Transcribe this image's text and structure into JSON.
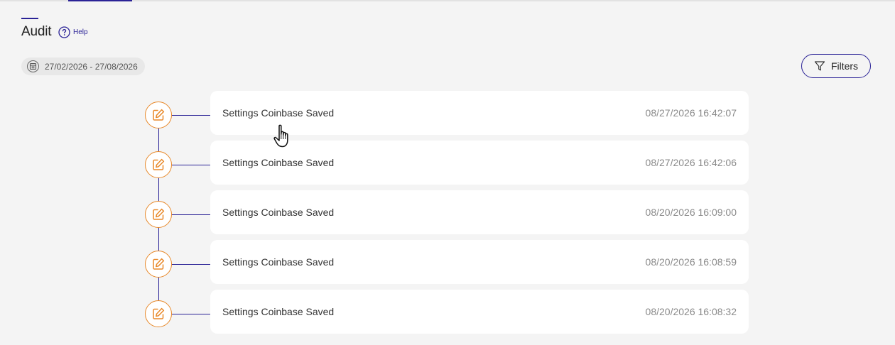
{
  "page": {
    "title": "Audit",
    "help_label": "Help"
  },
  "date_range": {
    "label": "27/02/2026 - 27/08/2026",
    "icon": "calendar-icon"
  },
  "filters": {
    "label": "Filters",
    "icon": "filter-icon"
  },
  "colors": {
    "accent": "#2a2296",
    "node_orange": "#e8892a",
    "background": "#f4f4f4"
  },
  "audit_entries": [
    {
      "event": "Settings Coinbase Saved",
      "timestamp": "08/27/2026 16:42:07",
      "icon": "edit-icon"
    },
    {
      "event": "Settings Coinbase Saved",
      "timestamp": "08/27/2026 16:42:06",
      "icon": "edit-icon"
    },
    {
      "event": "Settings Coinbase Saved",
      "timestamp": "08/20/2026 16:09:00",
      "icon": "edit-icon"
    },
    {
      "event": "Settings Coinbase Saved",
      "timestamp": "08/20/2026 16:08:59",
      "icon": "edit-icon"
    },
    {
      "event": "Settings Coinbase Saved",
      "timestamp": "08/20/2026 16:08:32",
      "icon": "edit-icon"
    }
  ]
}
